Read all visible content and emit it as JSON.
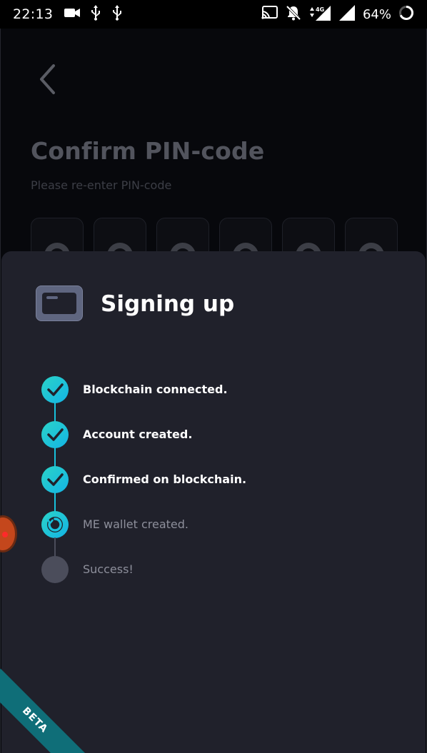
{
  "status_bar": {
    "time": "22:13",
    "battery_percent": "64%",
    "left_icons": [
      "video-camera-icon",
      "usb-icon",
      "usb-icon"
    ],
    "right_icons": [
      "cast-icon",
      "notifications-off-icon",
      "signal-4g-icon",
      "signal-icon",
      "battery-icon"
    ]
  },
  "background_screen": {
    "title": "Confirm PIN-code",
    "subtitle": "Please re-enter PIN-code",
    "pin_slots": 6
  },
  "sheet": {
    "title": "Signing up",
    "steps": [
      {
        "label": "Blockchain connected.",
        "state": "done"
      },
      {
        "label": "Account created.",
        "state": "done"
      },
      {
        "label": "Confirmed on blockchain.",
        "state": "done"
      },
      {
        "label": "ME wallet created.",
        "state": "in-progress"
      },
      {
        "label": "Success!",
        "state": "pending"
      }
    ]
  },
  "ribbon": {
    "label": "BETA"
  },
  "colors": {
    "accent_start": "#2bd3c7",
    "accent_end": "#13b4e6",
    "sheet_background": "#20212b",
    "pending": "#4b4d5b",
    "ribbon": "#0f6e78"
  }
}
